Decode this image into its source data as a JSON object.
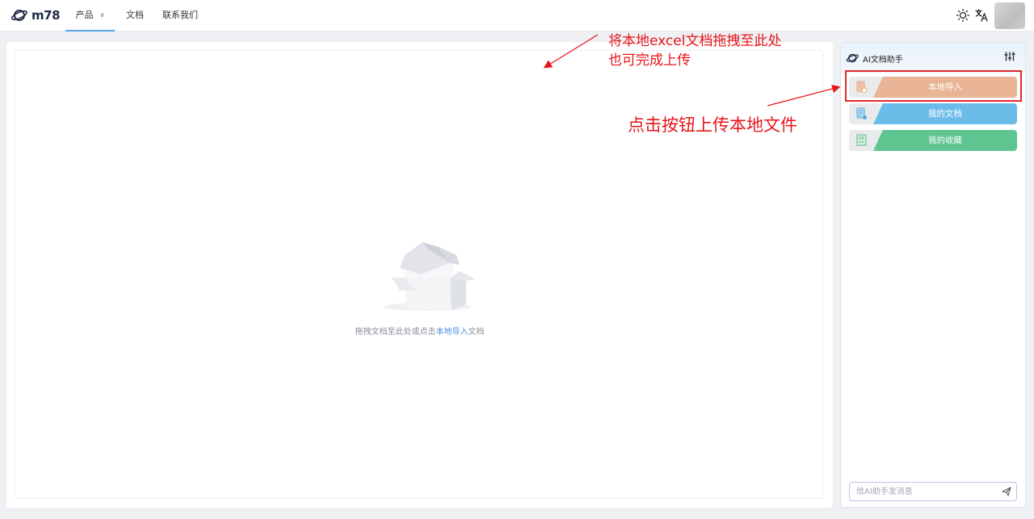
{
  "topbar": {
    "logo_text": "m78",
    "nav": [
      {
        "label": "产品",
        "has_caret": true,
        "active": true
      },
      {
        "label": "文档"
      },
      {
        "label": "联系我们"
      }
    ],
    "icons": [
      "sun-icon",
      "translate-icon"
    ]
  },
  "main": {
    "hint_prefix": "拖拽文档至此处或点击",
    "hint_link": "本地导入",
    "hint_suffix": "文档"
  },
  "annotations": {
    "drag_line1": "将本地excel文档拖拽至此处",
    "drag_line2": "也可完成上传",
    "click_line": "点击按钮上传本地文件"
  },
  "side_panel": {
    "title": "AI文档助手",
    "buttons": [
      {
        "label": "本地导入",
        "color": "#e8b495",
        "icon": "file-import-icon"
      },
      {
        "label": "我的文档",
        "color": "#6cbcea",
        "icon": "my-documents-icon"
      },
      {
        "label": "我的收藏",
        "color": "#5ec590",
        "icon": "favorites-icon"
      }
    ],
    "chat_placeholder": "给AI助手发消息"
  },
  "colors": {
    "accent": "#5aa3e6",
    "link": "#4a90e2",
    "annotation": "#e8141a"
  }
}
